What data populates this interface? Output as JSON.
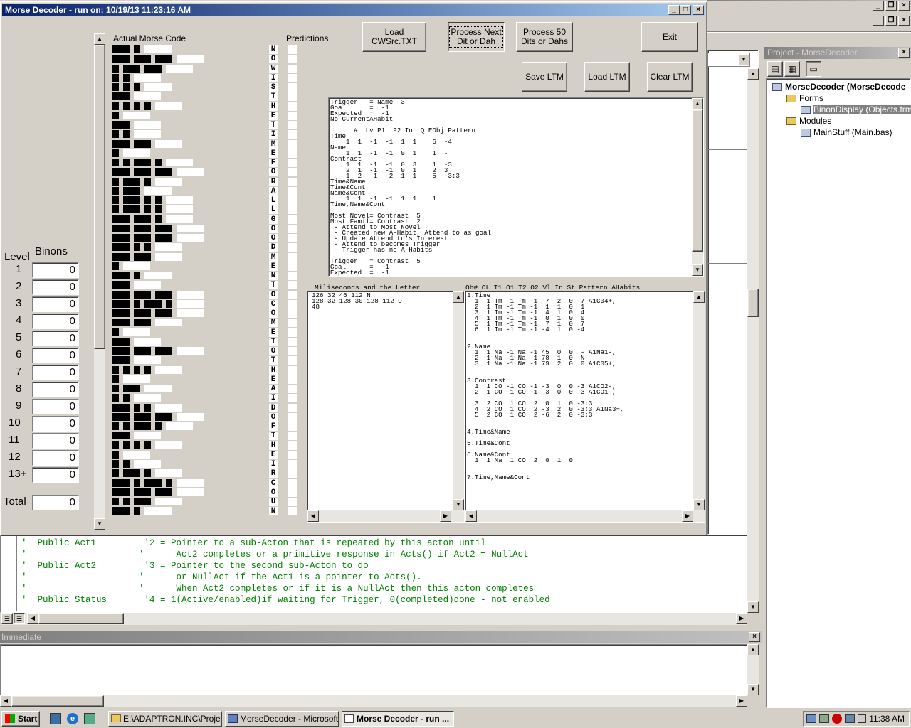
{
  "ide": {
    "project_title": "Project - MorseDecoder",
    "tree": [
      {
        "label": "MorseDecoder (MorseDecode",
        "indent": 0,
        "bold": true
      },
      {
        "label": "Forms",
        "indent": 1
      },
      {
        "label": "BinonDisplay (Objects.frm",
        "indent": 2,
        "selected": true
      },
      {
        "label": "Modules",
        "indent": 1
      },
      {
        "label": "MainStuff (Main.bas)",
        "indent": 2
      }
    ],
    "code_lines": [
      "'  Public Act1         '2 = Pointer to a sub-Acton that is repeated by this acton until",
      "'                     '      Act2 completes or a primitive response in Acts() if Act2 = NullAct",
      "'  Public Act2         '3 = Pointer to the second sub-Acton to do",
      "'                     '      or NullAct if the Act1 is a pointer to Acts().",
      "'                     '      When Act2 completes or if it is a NullAct then this acton completes",
      "'  Public Status       '4 = 1(Active/enabled)if waiting for Trigger, 0(completed)done - not enabled"
    ],
    "immediate_title": "Immediate"
  },
  "window": {
    "title": "Morse Decoder - run on: 10/19/13  11:23:16 AM",
    "buttons": {
      "load": "Load\nCWSrc.TXT",
      "next": "Process Next\nDit or Dah",
      "fifty": "Process 50\nDits or Dahs",
      "exit": "Exit",
      "save_ltm": "Save LTM",
      "load_ltm": "Load LTM",
      "clear_ltm": "Clear LTM"
    },
    "labels": {
      "actual": "Actual Morse Code",
      "predictions": "Predictions",
      "level": "Level",
      "binons": "Binons",
      "total": "Total",
      "ms_header": "Miliseconds and the Letter",
      "ob_header": "Ob# OL T1 O1 T2 O2 Vl In St Pattern AHabits"
    },
    "levels": [
      {
        "level": "1",
        "value": "0"
      },
      {
        "level": "2",
        "value": "0"
      },
      {
        "level": "3",
        "value": "0"
      },
      {
        "level": "4",
        "value": "0"
      },
      {
        "level": "5",
        "value": "0"
      },
      {
        "level": "6",
        "value": "0"
      },
      {
        "level": "7",
        "value": "0"
      },
      {
        "level": "8",
        "value": "0"
      },
      {
        "level": "9",
        "value": "0"
      },
      {
        "level": "10",
        "value": "0"
      },
      {
        "level": "11",
        "value": "0"
      },
      {
        "level": "12",
        "value": "0"
      },
      {
        "level": "13+",
        "value": "0"
      }
    ],
    "total": "0",
    "letters": [
      "N",
      "O",
      "W",
      "I",
      "S",
      "T",
      "H",
      "E",
      "T",
      "I",
      "M",
      "E",
      "F",
      "O",
      "R",
      "A",
      "L",
      "L",
      "G",
      "O",
      "O",
      "D",
      "M",
      "E",
      "N",
      "T",
      "O",
      "C",
      "O",
      "M",
      "E",
      "T",
      "O",
      "T",
      "H",
      "E",
      "A",
      "I",
      "D",
      "O",
      "F",
      "T",
      "H",
      "E",
      "I",
      "R",
      "C",
      "O",
      "U",
      "N"
    ],
    "trigger_text": "Trigger   = Name  3\nGoal      =  -1\nExpected  =  -1\nNo CurrentAHabit\n\n      #  Lv P1  P2 In  Q EObj Pattern\nTime\n    1  1  -1  -1  1  1    6  -4\nName\n    1  1  -1  -1  0  1    1  -\nContrast\n    1  1  -1  -1  0  3    1  -3\n    2  1  -1  -1  0  1    2  3\n    1  2   1   2  1  1    5  -3:3\nTime&Name\nTime&Cont\nName&Cont\n    1  1  -1  -1  1  1    1\nTime,Name&Cont\n\nMost Novel= Contrast  5\nMost Famil= Contrast  2\n - Attend to Most Novel\n - Created new A-Habit, Attend to as goal\n - Update Attend to's Interest\n - Attend to becomes Trigger\n - Trigger has no A-Habits\n\nTrigger   = Contrast  5\nGoal      =  -1\nExpected  =  -1",
    "ms_text": "126 32 46 112 N\n128 32 128 30 128 112 O\n48",
    "ob_text": "1.Time\n  1  1 Tm -1 Tm -1 -7  2  0 -7 A1C04+,\n  2  1 Tm -1 Tm -1  1  1  0  1\n  3  1 Tm -1 Tm -1  4  1  0  4\n  4  1 Tm -1 Tm -1  0  1  0  0\n  5  1 Tm -1 Tm -1  7  1  0  7\n  6  1 Tm -1 Tm -1 -4  1  0 -4\n\n\n2.Name\n  1  1 Na -1 Na -1 45  0  0  - A1Na1-,\n  2  1 Na -1 Na -1 78  1  0  N\n  3  1 Na -1 Na -1 79  2  0  0 A1C05+,\n\n\n3.Contrast\n  1  1 CO -1 CO -1 -3  0  0 -3 A1CO2-,\n  2  1 CO -1 CO -1  3  0  0  3 A1CO1-,\n\n  3  2 CO  1 CO  2  0  1  0 -3:3\n  4  2 CO  1 CO  2 -3  2  0 -3:3 A1Na3+,\n  5  2 CO  1 CO  2 -6  2  0 -3:3\n\n\n4.Time&Name\n\n5.Time&Cont\n\n6.Name&Cont\n  1  1 Na  1 CO  2  0  1  0\n\n\n7.Time,Name&Cont"
  },
  "taskbar": {
    "start": "Start",
    "tasks": [
      "E:\\ADAPTRON.INC\\Proje...",
      "MorseDecoder - Microsoft ...",
      "Morse Decoder - run ..."
    ],
    "clock": "11:38 AM"
  },
  "colors": {
    "titlebar": "#0a246a",
    "code_green": "#008000",
    "desktop": "#d4d0c8"
  }
}
